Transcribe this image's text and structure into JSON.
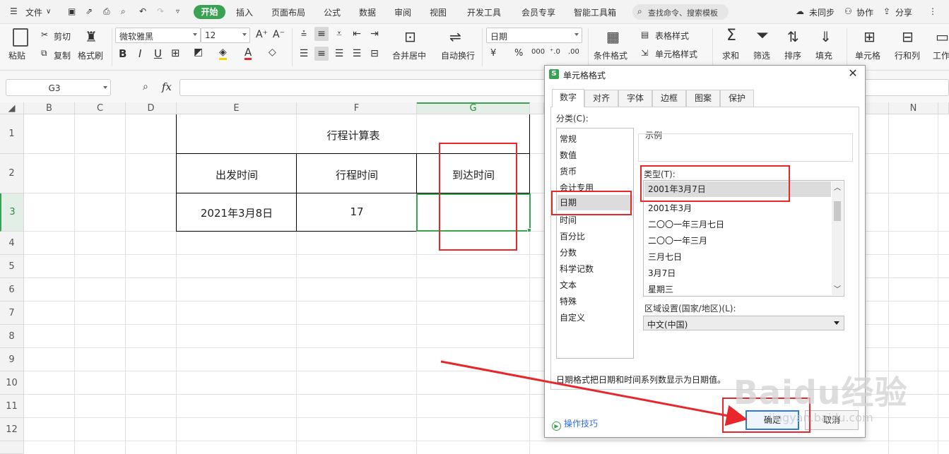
{
  "menubar": {
    "file_label": "文件",
    "tabs": [
      "开始",
      "插入",
      "页面布局",
      "公式",
      "数据",
      "审阅",
      "视图",
      "开发工具",
      "会员专享",
      "智能工具箱"
    ],
    "search_placeholder": "查找命令、搜索模板",
    "sync_label": "未同步",
    "collab_label": "协作",
    "share_label": "分享"
  },
  "ribbon": {
    "paste_label": "粘贴",
    "cut_label": "剪切",
    "copy_label": "复制",
    "format_painter_label": "格式刷",
    "font_name": "微软雅黑",
    "font_size": "12",
    "merge_center_label": "合并居中",
    "wrap_text_label": "自动换行",
    "number_format": "日期",
    "conditional_format_label": "条件格式",
    "table_style_label": "表格样式",
    "cell_style_label": "单元格样式",
    "sum_label": "求和",
    "filter_label": "筛选",
    "sort_label": "排序",
    "fill_label": "填充",
    "cell_label": "单元格",
    "row_col_label": "行和列",
    "worksheet_label": "工作"
  },
  "formula_bar": {
    "name_box": "G3",
    "fx_label": "fx",
    "content": ""
  },
  "sheet": {
    "columns": [
      "B",
      "C",
      "D",
      "E",
      "F",
      "G",
      "N"
    ],
    "selected_column": "G",
    "rows": [
      "1",
      "2",
      "3",
      "4",
      "5",
      "6",
      "7",
      "8",
      "9",
      "10",
      "11",
      "12"
    ],
    "selected_row": "3",
    "table": {
      "title": "行程计算表",
      "headers": [
        "出发时间",
        "行程时间",
        "到达时间"
      ],
      "row": [
        "2021年3月8日",
        "17",
        ""
      ]
    }
  },
  "dialog": {
    "title": "单元格格式",
    "tabs": [
      "数字",
      "对齐",
      "字体",
      "边框",
      "图案",
      "保护"
    ],
    "active_tab": "数字",
    "category_label": "分类(C):",
    "categories": [
      "常规",
      "数值",
      "货币",
      "会计专用",
      "日期",
      "时间",
      "百分比",
      "分数",
      "科学记数",
      "文本",
      "特殊",
      "自定义"
    ],
    "selected_category": "日期",
    "sample_label": "示例",
    "type_label": "类型(T):",
    "types": [
      "2001年3月7日",
      "2001年3月",
      "二〇〇一年三月七日",
      "二〇〇一年三月",
      "三月七日",
      "3月7日",
      "星期三"
    ],
    "selected_type": "2001年3月7日",
    "locale_label": "区域设置(国家/地区)(L):",
    "locale_value": "中文(中国)",
    "hint": "日期格式把日期和时间系列数显示为日期值。",
    "tips_label": "操作技巧",
    "ok_label": "确定",
    "cancel_label": "取消"
  },
  "watermark": {
    "main": "Baidu经验",
    "sub": "jingyan.baidu.com"
  },
  "colors": {
    "accent_green": "#3aa353",
    "annotation_red": "#e8262b",
    "primary_button_border": "#2e7bd6"
  }
}
